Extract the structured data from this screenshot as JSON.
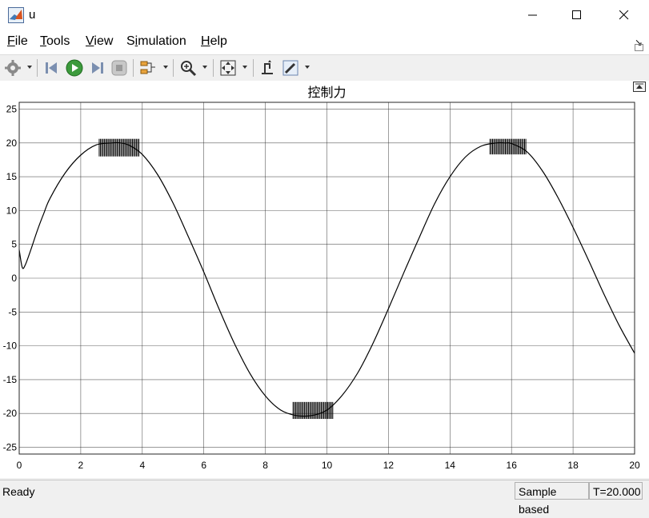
{
  "window": {
    "title": "u"
  },
  "menu": [
    {
      "label": "File",
      "mnemonic": "F",
      "rest": "ile"
    },
    {
      "label": "Tools",
      "mnemonic": "T",
      "rest": "ools"
    },
    {
      "label": "View",
      "mnemonic": "V",
      "rest": "iew"
    },
    {
      "label": "Simulation",
      "mnemonic": "i",
      "pre": "S",
      "rest": "mulation"
    },
    {
      "label": "Help",
      "mnemonic": "H",
      "rest": "elp"
    }
  ],
  "toolbar": {
    "icons": [
      "gear-icon",
      "step-back-icon",
      "run-icon",
      "step-forward-icon",
      "stop-icon",
      "signal-selector-icon",
      "zoom-icon",
      "autoscale-icon",
      "cursor-measure-icon",
      "highlight-icon"
    ]
  },
  "status": {
    "ready": "Ready",
    "mode": "Sample based",
    "time": "T=20.000"
  },
  "colors": {
    "line": "#000000",
    "grid": "#262626",
    "background": "#ffffff"
  },
  "chart_data": {
    "type": "line",
    "title": "控制力",
    "xlabel": "",
    "ylabel": "",
    "xlim": [
      0,
      20
    ],
    "ylim": [
      -26,
      26
    ],
    "xticks": [
      0,
      2,
      4,
      6,
      8,
      10,
      12,
      14,
      16,
      18,
      20
    ],
    "yticks": [
      25,
      20,
      15,
      10,
      5,
      0,
      -5,
      -10,
      -15,
      -20,
      -25
    ],
    "grid": true,
    "series": [
      {
        "x": [
          0,
          0.1,
          0.2,
          0.4,
          0.6,
          0.8,
          1.0,
          1.5,
          2.0,
          2.5,
          3.0,
          3.3,
          3.6,
          4.0,
          4.5,
          5.0,
          5.5,
          6.0,
          6.5,
          7.0,
          7.5,
          8.0,
          8.5,
          9.0,
          9.5,
          10.0,
          10.5,
          11.0,
          11.5,
          12.0,
          12.5,
          13.0,
          13.5,
          14.0,
          14.5,
          15.0,
          15.5,
          15.8,
          16.0,
          16.5,
          17.0,
          17.5,
          18.0,
          18.5,
          19.0,
          19.5,
          20.0
        ],
        "y": [
          4.2,
          1.6,
          2.0,
          4.5,
          7.2,
          9.6,
          11.8,
          15.6,
          18.2,
          19.7,
          20.0,
          20.0,
          19.6,
          18.3,
          15.3,
          11.1,
          6.1,
          0.9,
          -4.6,
          -9.7,
          -14.1,
          -17.4,
          -19.5,
          -20.3,
          -20.3,
          -19.5,
          -17.3,
          -14.0,
          -9.6,
          -4.5,
          0.8,
          6.0,
          11.0,
          15.0,
          17.9,
          19.5,
          20.0,
          20.0,
          19.9,
          18.7,
          15.9,
          12.0,
          7.5,
          2.7,
          -2.3,
          -7.0,
          -11.1
        ]
      }
    ],
    "chatter": [
      {
        "x_from": 2.6,
        "x_to": 3.9,
        "y_top": 20.6,
        "y_bottom": 18.0
      },
      {
        "x_from": 8.9,
        "x_to": 10.2,
        "y_top": -18.3,
        "y_bottom": -20.8
      },
      {
        "x_from": 15.3,
        "x_to": 16.5,
        "y_top": 20.6,
        "y_bottom": 18.3
      }
    ]
  }
}
